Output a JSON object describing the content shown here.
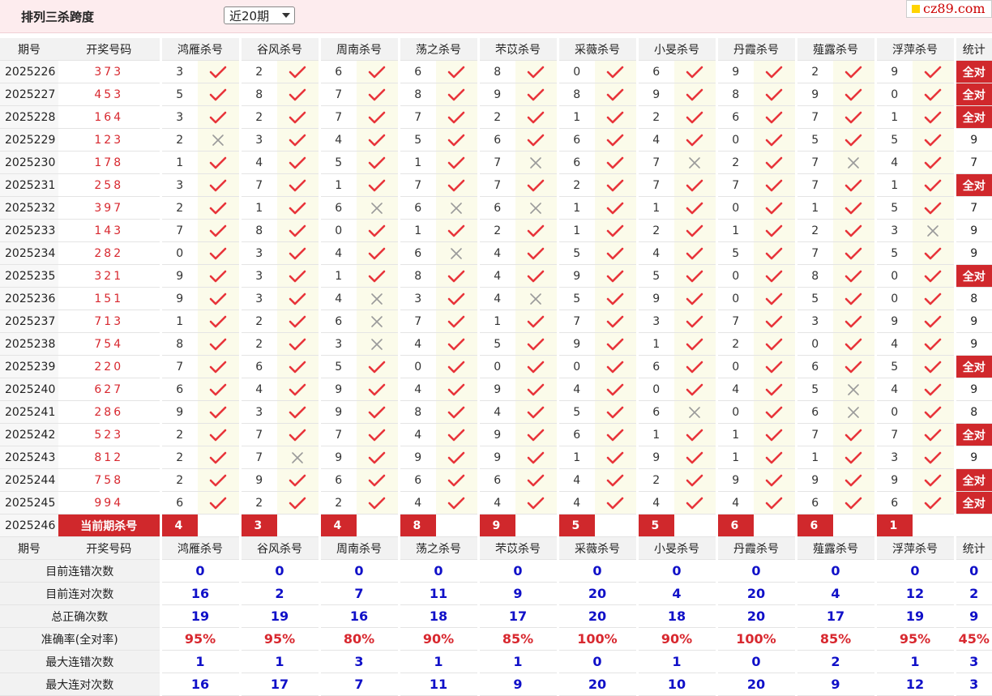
{
  "header": {
    "title": "排列三杀跨度",
    "period_select": "近20期",
    "site_logo": "cz89.com"
  },
  "columns": {
    "issue": "期号",
    "draw": "开奖号码",
    "experts": [
      "鸿雁杀号",
      "谷风杀号",
      "周南杀号",
      "荡之杀号",
      "芣苡杀号",
      "采薇杀号",
      "小旻杀号",
      "丹霞杀号",
      "薤露杀号",
      "浮萍杀号"
    ],
    "stat": "统计"
  },
  "rows": [
    {
      "issue": "2025226",
      "draw": "373",
      "kills": [
        3,
        2,
        6,
        6,
        8,
        0,
        6,
        9,
        2,
        9
      ],
      "ok": [
        1,
        1,
        1,
        1,
        1,
        1,
        1,
        1,
        1,
        1
      ],
      "stat": "全对"
    },
    {
      "issue": "2025227",
      "draw": "453",
      "kills": [
        5,
        8,
        7,
        8,
        9,
        8,
        9,
        8,
        9,
        0
      ],
      "ok": [
        1,
        1,
        1,
        1,
        1,
        1,
        1,
        1,
        1,
        1
      ],
      "stat": "全对"
    },
    {
      "issue": "2025228",
      "draw": "164",
      "kills": [
        3,
        2,
        7,
        7,
        2,
        1,
        2,
        6,
        7,
        1
      ],
      "ok": [
        1,
        1,
        1,
        1,
        1,
        1,
        1,
        1,
        1,
        1
      ],
      "stat": "全对"
    },
    {
      "issue": "2025229",
      "draw": "123",
      "kills": [
        2,
        3,
        4,
        5,
        6,
        6,
        4,
        0,
        5,
        5
      ],
      "ok": [
        0,
        1,
        1,
        1,
        1,
        1,
        1,
        1,
        1,
        1
      ],
      "stat": "9"
    },
    {
      "issue": "2025230",
      "draw": "178",
      "kills": [
        1,
        4,
        5,
        1,
        7,
        6,
        7,
        2,
        7,
        4
      ],
      "ok": [
        1,
        1,
        1,
        1,
        0,
        1,
        0,
        1,
        0,
        1
      ],
      "stat": "7"
    },
    {
      "issue": "2025231",
      "draw": "258",
      "kills": [
        3,
        7,
        1,
        7,
        7,
        2,
        7,
        7,
        7,
        1
      ],
      "ok": [
        1,
        1,
        1,
        1,
        1,
        1,
        1,
        1,
        1,
        1
      ],
      "stat": "全对"
    },
    {
      "issue": "2025232",
      "draw": "397",
      "kills": [
        2,
        1,
        6,
        6,
        6,
        1,
        1,
        0,
        1,
        5
      ],
      "ok": [
        1,
        1,
        0,
        0,
        0,
        1,
        1,
        1,
        1,
        1
      ],
      "stat": "7"
    },
    {
      "issue": "2025233",
      "draw": "143",
      "kills": [
        7,
        8,
        0,
        1,
        2,
        1,
        2,
        1,
        2,
        3
      ],
      "ok": [
        1,
        1,
        1,
        1,
        1,
        1,
        1,
        1,
        1,
        0
      ],
      "stat": "9"
    },
    {
      "issue": "2025234",
      "draw": "282",
      "kills": [
        0,
        3,
        4,
        6,
        4,
        5,
        4,
        5,
        7,
        5
      ],
      "ok": [
        1,
        1,
        1,
        0,
        1,
        1,
        1,
        1,
        1,
        1
      ],
      "stat": "9"
    },
    {
      "issue": "2025235",
      "draw": "321",
      "kills": [
        9,
        3,
        1,
        8,
        4,
        9,
        5,
        0,
        8,
        0
      ],
      "ok": [
        1,
        1,
        1,
        1,
        1,
        1,
        1,
        1,
        1,
        1
      ],
      "stat": "全对"
    },
    {
      "issue": "2025236",
      "draw": "151",
      "kills": [
        9,
        3,
        4,
        3,
        4,
        5,
        9,
        0,
        5,
        0
      ],
      "ok": [
        1,
        1,
        0,
        1,
        0,
        1,
        1,
        1,
        1,
        1
      ],
      "stat": "8"
    },
    {
      "issue": "2025237",
      "draw": "713",
      "kills": [
        1,
        2,
        6,
        7,
        1,
        7,
        3,
        7,
        3,
        9
      ],
      "ok": [
        1,
        1,
        0,
        1,
        1,
        1,
        1,
        1,
        1,
        1
      ],
      "stat": "9"
    },
    {
      "issue": "2025238",
      "draw": "754",
      "kills": [
        8,
        2,
        3,
        4,
        5,
        9,
        1,
        2,
        0,
        4
      ],
      "ok": [
        1,
        1,
        0,
        1,
        1,
        1,
        1,
        1,
        1,
        1
      ],
      "stat": "9"
    },
    {
      "issue": "2025239",
      "draw": "220",
      "kills": [
        7,
        6,
        5,
        0,
        0,
        0,
        6,
        0,
        6,
        5
      ],
      "ok": [
        1,
        1,
        1,
        1,
        1,
        1,
        1,
        1,
        1,
        1
      ],
      "stat": "全对"
    },
    {
      "issue": "2025240",
      "draw": "627",
      "kills": [
        6,
        4,
        9,
        4,
        9,
        4,
        0,
        4,
        5,
        4
      ],
      "ok": [
        1,
        1,
        1,
        1,
        1,
        1,
        1,
        1,
        0,
        1
      ],
      "stat": "9"
    },
    {
      "issue": "2025241",
      "draw": "286",
      "kills": [
        9,
        3,
        9,
        8,
        4,
        5,
        6,
        0,
        6,
        0
      ],
      "ok": [
        1,
        1,
        1,
        1,
        1,
        1,
        0,
        1,
        0,
        1
      ],
      "stat": "8"
    },
    {
      "issue": "2025242",
      "draw": "523",
      "kills": [
        2,
        7,
        7,
        4,
        9,
        6,
        1,
        1,
        7,
        7
      ],
      "ok": [
        1,
        1,
        1,
        1,
        1,
        1,
        1,
        1,
        1,
        1
      ],
      "stat": "全对"
    },
    {
      "issue": "2025243",
      "draw": "812",
      "kills": [
        2,
        7,
        9,
        9,
        9,
        1,
        9,
        1,
        1,
        3
      ],
      "ok": [
        1,
        0,
        1,
        1,
        1,
        1,
        1,
        1,
        1,
        1
      ],
      "stat": "9"
    },
    {
      "issue": "2025244",
      "draw": "758",
      "kills": [
        2,
        9,
        6,
        6,
        6,
        4,
        2,
        9,
        9,
        9
      ],
      "ok": [
        1,
        1,
        1,
        1,
        1,
        1,
        1,
        1,
        1,
        1
      ],
      "stat": "全对"
    },
    {
      "issue": "2025245",
      "draw": "994",
      "kills": [
        6,
        2,
        2,
        4,
        4,
        4,
        4,
        4,
        6,
        6
      ],
      "ok": [
        1,
        1,
        1,
        1,
        1,
        1,
        1,
        1,
        1,
        1
      ],
      "stat": "全对"
    }
  ],
  "current": {
    "issue": "2025246",
    "label": "当前期杀号",
    "kills": [
      "4",
      "3",
      "4",
      "8",
      "9",
      "5",
      "5",
      "6",
      "6",
      "1"
    ]
  },
  "summary": [
    {
      "label": "目前连错次数",
      "values": [
        "0",
        "0",
        "0",
        "0",
        "0",
        "0",
        "0",
        "0",
        "0",
        "0"
      ],
      "stat": "0",
      "color": "blue"
    },
    {
      "label": "目前连对次数",
      "values": [
        "16",
        "2",
        "7",
        "11",
        "9",
        "20",
        "4",
        "20",
        "4",
        "12"
      ],
      "stat": "2",
      "color": "blue"
    },
    {
      "label": "总正确次数",
      "values": [
        "19",
        "19",
        "16",
        "18",
        "17",
        "20",
        "18",
        "20",
        "17",
        "19"
      ],
      "stat": "9",
      "color": "blue"
    },
    {
      "label": "准确率(全对率)",
      "values": [
        "95%",
        "95%",
        "80%",
        "90%",
        "85%",
        "100%",
        "90%",
        "100%",
        "85%",
        "95%"
      ],
      "stat": "45%",
      "color": "red"
    },
    {
      "label": "最大连错次数",
      "values": [
        "1",
        "1",
        "3",
        "1",
        "1",
        "0",
        "1",
        "0",
        "2",
        "1"
      ],
      "stat": "3",
      "color": "blue"
    },
    {
      "label": "最大连对次数",
      "values": [
        "16",
        "17",
        "7",
        "11",
        "9",
        "20",
        "10",
        "20",
        "9",
        "12"
      ],
      "stat": "3",
      "color": "blue"
    }
  ],
  "colors": {
    "accent": "#d0282c",
    "check": "#e8343a",
    "cross": "#9a9a9a",
    "blue_value": "#1010c8"
  }
}
